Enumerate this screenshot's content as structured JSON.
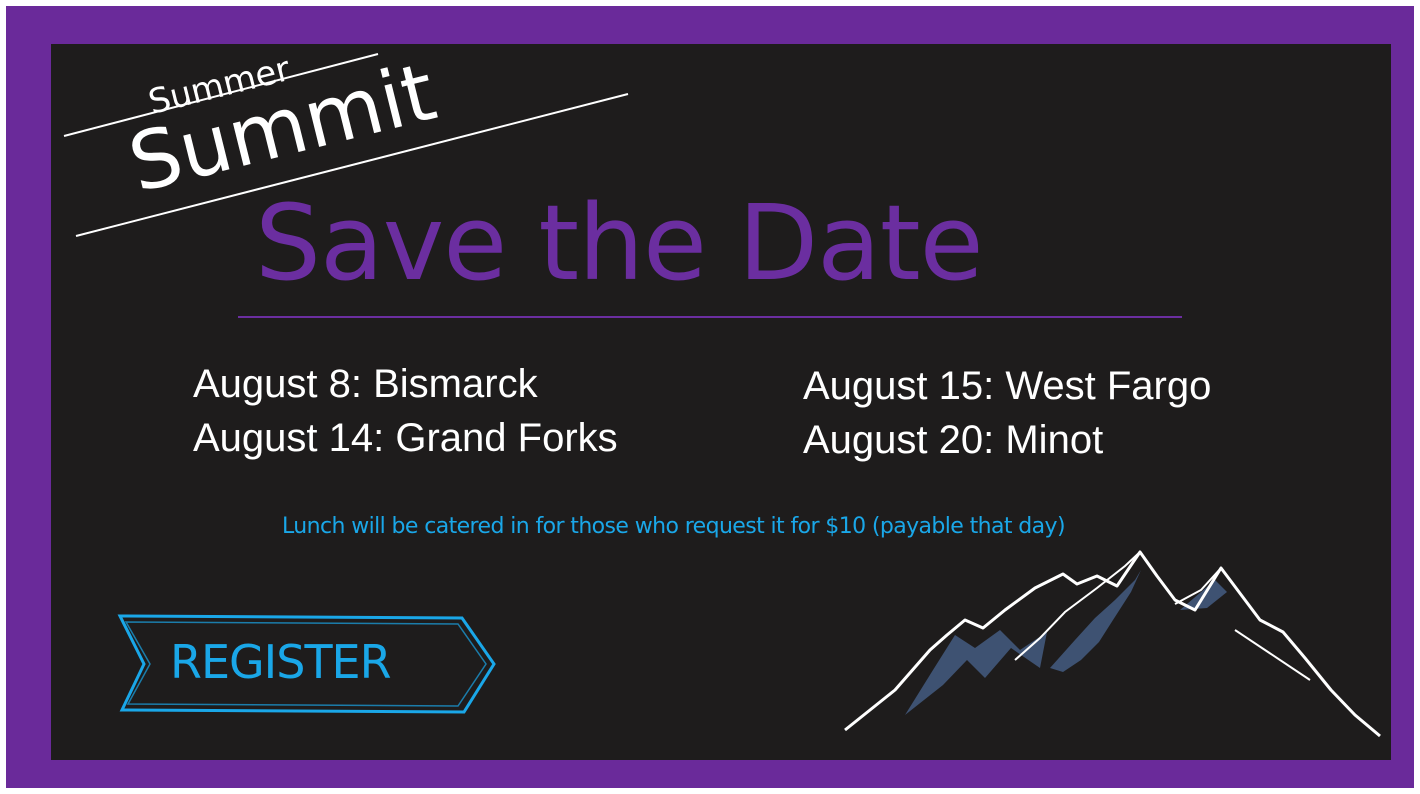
{
  "colors": {
    "frame": "#6a2a9a",
    "panel": "#1e1c1c",
    "headline": "#6b2ea0",
    "accent": "#1aa7e8",
    "text": "#ffffff",
    "mountain_fill": "#3e5272"
  },
  "logo": {
    "small_word": "Summer",
    "big_word": "Summit"
  },
  "headline": "Save the Date",
  "dates_left": [
    "August 8: Bismarck",
    "August 14: Grand Forks"
  ],
  "dates_right": [
    "August 15: West Fargo",
    "August 20: Minot"
  ],
  "lunch_note": "Lunch will be catered in for those who request it for $10 (payable that day)",
  "register_button": {
    "label": "REGISTER",
    "icon": "arrow-banner-icon"
  },
  "decoration": {
    "icon": "mountains-icon"
  }
}
